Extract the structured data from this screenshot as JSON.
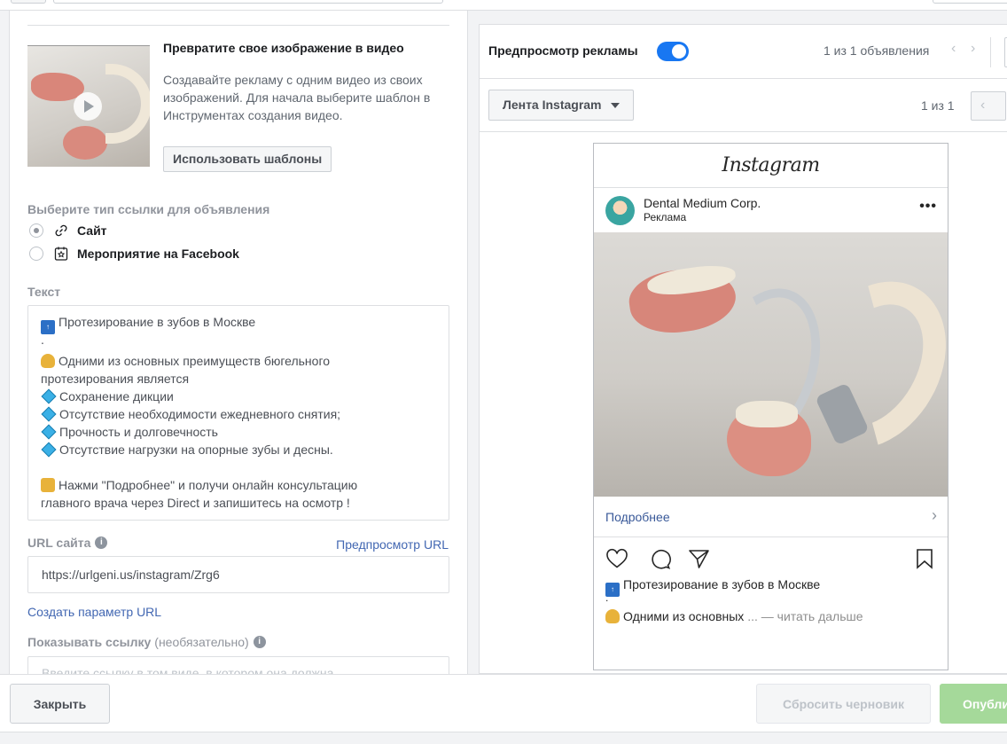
{
  "video_promo": {
    "title": "Превратите свое изображение в видео",
    "description": "Создавайте рекламу с одним видео из своих изображений. Для начала выберите шаблон в Инструментах создания видео.",
    "button": "Использовать шаблоны"
  },
  "link_type": {
    "label": "Выберите тип ссылки для объявления",
    "options": [
      {
        "label": "Сайт",
        "selected": true,
        "icon": "link-icon"
      },
      {
        "label": "Мероприятие на Facebook",
        "selected": false,
        "icon": "event-icon"
      }
    ]
  },
  "text_section": {
    "label": "Текст",
    "lines": [
      "Протезирование в зубов в Москве",
      ".",
      "Одними из основных преимуществ бюгельного",
      "протезирования является",
      "Сохранение дикции",
      "Отсутствие необходимости ежедневного снятия;",
      "Прочность и долговечность",
      "Отсутствие нагрузки на опорные зубы и десны.",
      "",
      "Нажми \"Подробнее\" и получи онлайн консультацию",
      "главного врача через Direct и запишитесь на осмотр !"
    ]
  },
  "url": {
    "label": "URL сайта",
    "preview_link": "Предпросмотр URL",
    "value": "https://urlgeni.us/instagram/Zrg6",
    "param_link": "Создать параметр URL"
  },
  "display_link": {
    "label": "Показывать ссылку",
    "optional": "(необязательно)",
    "placeholder": "Введите ссылку в том виде, в котором она должна"
  },
  "preview": {
    "title": "Предпросмотр рекламы",
    "toggle_on": true,
    "count": "1 из 1 объявления",
    "placement": "Лента Instagram",
    "sub_count": "1 из 1"
  },
  "instagram": {
    "logo": "Instagram",
    "account": "Dental Medium Corp.",
    "sponsored": "Реклама",
    "cta": "Подробнее",
    "caption_line1": "Протезирование в зубов в Москве",
    "caption_dot": ".",
    "caption_line2": "Одними из основных",
    "caption_more": "... — читать дальше"
  },
  "footer": {
    "close": "Закрыть",
    "reset": "Сбросить черновик",
    "publish": "Опубликовать"
  },
  "colors": {
    "accent": "#1877f2",
    "link": "#4267b2",
    "publish_disabled": "#a5d99a"
  }
}
